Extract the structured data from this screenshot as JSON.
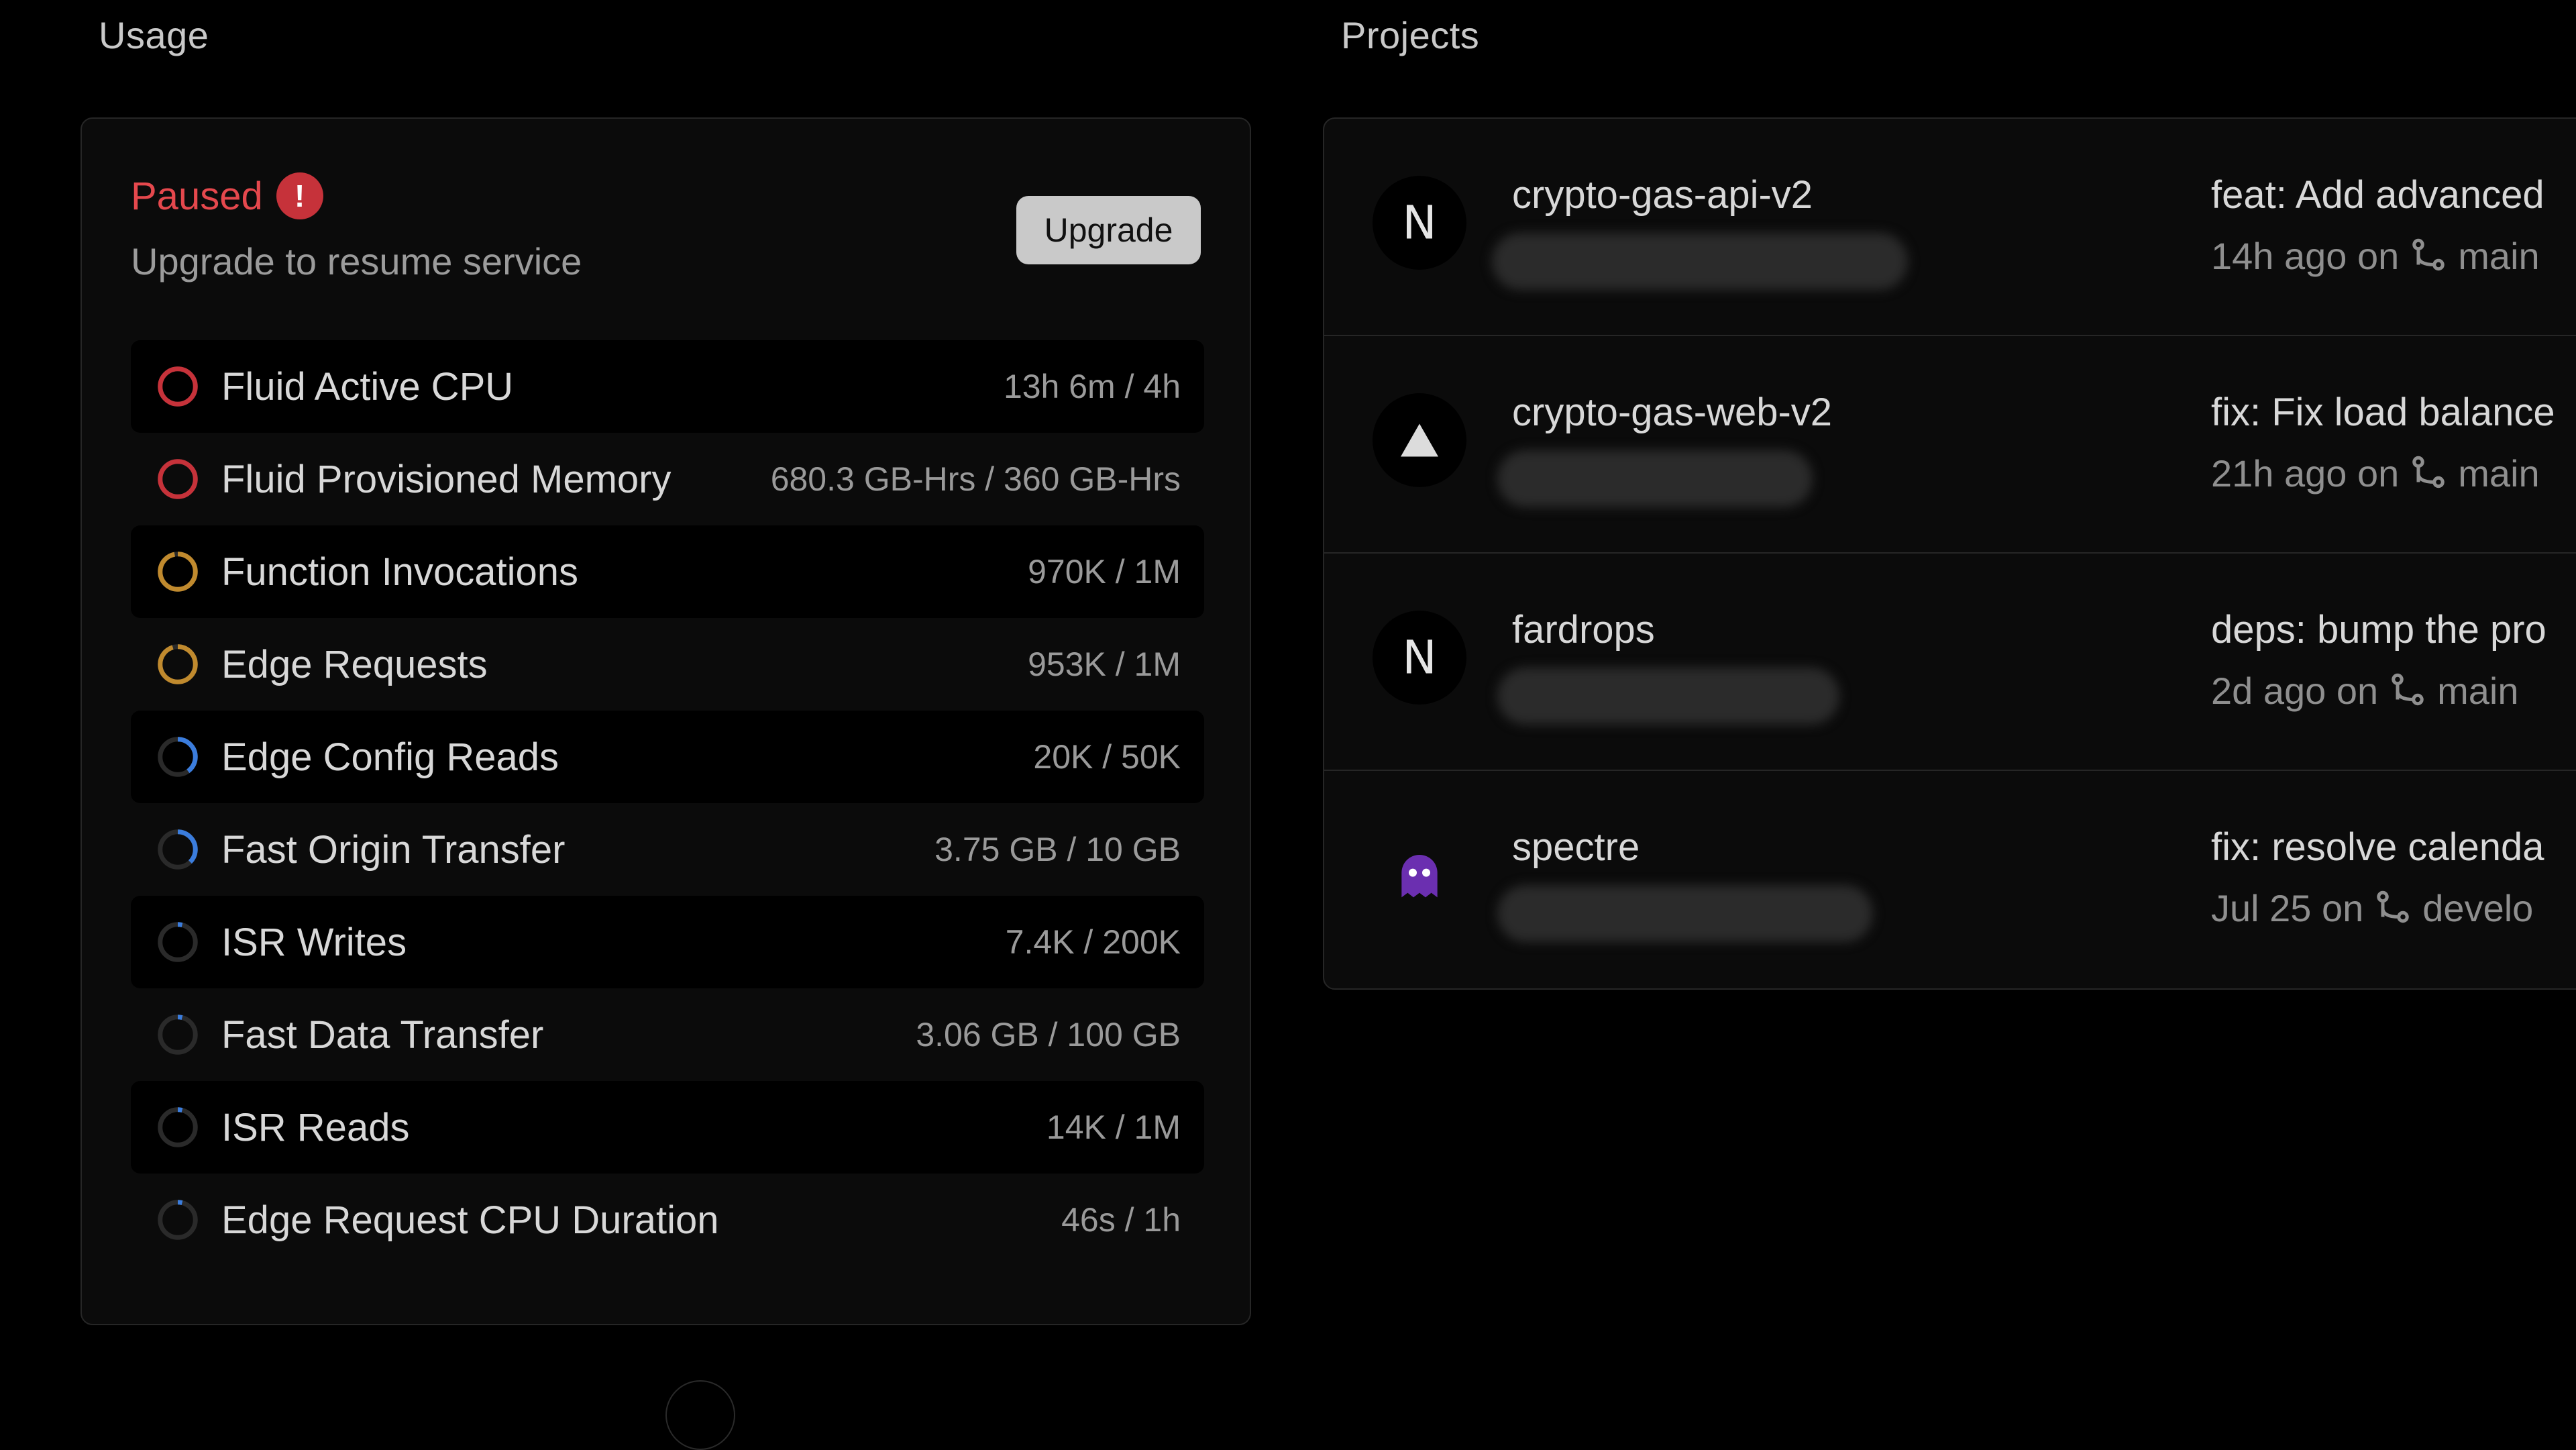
{
  "usage": {
    "title": "Usage",
    "status": "Paused",
    "subtitle": "Upgrade to resume service",
    "upgrade_label": "Upgrade",
    "colors": {
      "paused": "#e5484d",
      "red": "#c6323a",
      "amber": "#c08a2e",
      "blue": "#3b7ddd"
    },
    "metrics": [
      {
        "name": "Fluid Active CPU",
        "value": "13h 6m / 4h",
        "ring": "red",
        "fill": 1.0
      },
      {
        "name": "Fluid Provisioned Memory",
        "value": "680.3 GB-Hrs / 360 GB-Hrs",
        "ring": "red",
        "fill": 1.0
      },
      {
        "name": "Function Invocations",
        "value": "970K / 1M",
        "ring": "amber",
        "fill": 0.97
      },
      {
        "name": "Edge Requests",
        "value": "953K / 1M",
        "ring": "amber",
        "fill": 0.953
      },
      {
        "name": "Edge Config Reads",
        "value": "20K / 50K",
        "ring": "blue",
        "fill": 0.4
      },
      {
        "name": "Fast Origin Transfer",
        "value": "3.75 GB / 10 GB",
        "ring": "blue",
        "fill": 0.375
      },
      {
        "name": "ISR Writes",
        "value": "7.4K / 200K",
        "ring": "blue",
        "fill": 0.037
      },
      {
        "name": "Fast Data Transfer",
        "value": "3.06 GB / 100 GB",
        "ring": "blue",
        "fill": 0.031
      },
      {
        "name": "ISR Reads",
        "value": "14K / 1M",
        "ring": "blue",
        "fill": 0.014
      },
      {
        "name": "Edge Request CPU Duration",
        "value": "46s / 1h",
        "ring": "blue",
        "fill": 0.013
      }
    ]
  },
  "projects": {
    "title": "Projects",
    "items": [
      {
        "name": "crypto-gas-api-v2",
        "icon": "nextjs-icon",
        "commit": "feat: Add advanced",
        "time": "14h ago on",
        "branch": "main"
      },
      {
        "name": "crypto-gas-web-v2",
        "icon": "vercel-triangle-icon",
        "commit": "fix: Fix load balance",
        "time": "21h ago on",
        "branch": "main"
      },
      {
        "name": "fardrops",
        "icon": "nextjs-icon",
        "commit": "deps: bump the pro",
        "time": "2d ago on",
        "branch": "main"
      },
      {
        "name": "spectre",
        "icon": "ghost-icon",
        "commit": "fix: resolve calenda",
        "time": "Jul 25 on",
        "branch": "develo"
      }
    ]
  }
}
